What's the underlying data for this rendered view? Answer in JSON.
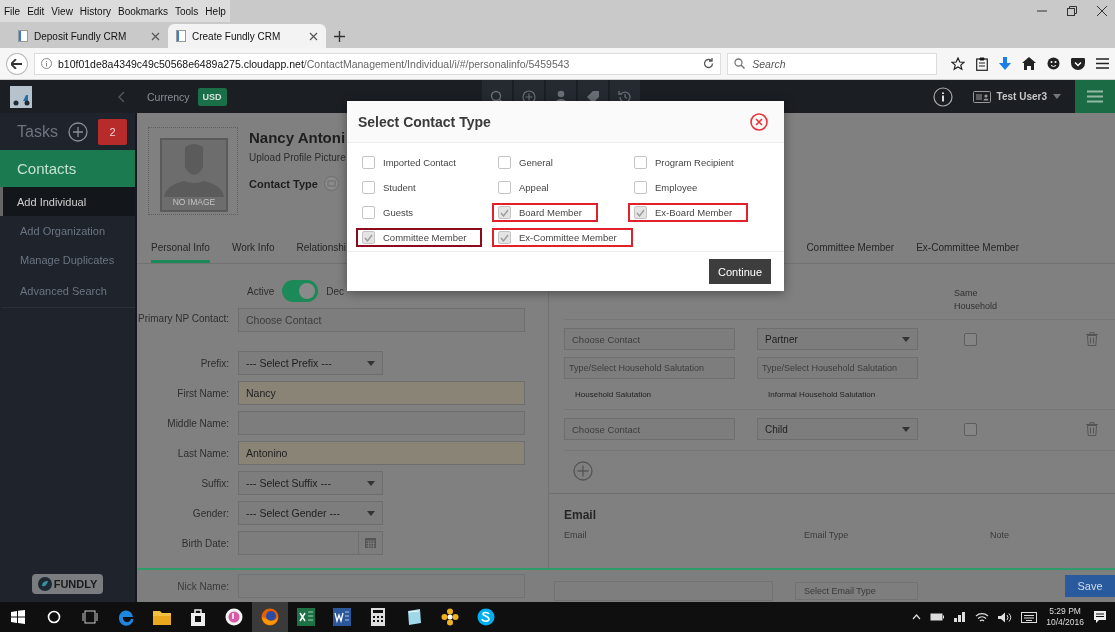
{
  "browser": {
    "menu": [
      "File",
      "Edit",
      "View",
      "History",
      "Bookmarks",
      "Tools",
      "Help"
    ],
    "tabs": [
      {
        "label": "Deposit Fundly CRM",
        "selected": false
      },
      {
        "label": "Create Fundly CRM",
        "selected": true
      }
    ],
    "url": {
      "host": "b10f01de8a4349c49c50568e6489a275.cloudapp.net",
      "path": "/ContactManagement/Individual/i/#/personalinfo/5459543"
    },
    "search": {
      "placeholder": "Search"
    }
  },
  "header": {
    "currency_label": "Currency",
    "currency": "USD",
    "user": "Test User3"
  },
  "sidebar": {
    "tasks": {
      "label": "Tasks",
      "count": "2"
    },
    "section": "Contacts",
    "items": [
      {
        "label": "Add Individual",
        "selected": true
      },
      {
        "label": "Add Organization",
        "selected": false
      },
      {
        "label": "Manage Duplicates",
        "selected": false
      },
      {
        "label": "Advanced Search",
        "selected": false
      }
    ],
    "logo": "FUNDLY"
  },
  "profile": {
    "name": "Nancy Antoni",
    "upload": "Upload Profile Picture",
    "no_image": "NO IMAGE",
    "contact_type": "Contact Type"
  },
  "tabs": {
    "left": [
      {
        "label": "Personal Info",
        "selected": true
      },
      {
        "label": "Work Info",
        "selected": false
      },
      {
        "label": "Relationshi",
        "selected": false
      }
    ],
    "right": [
      {
        "label": "Committee Member",
        "selected": false
      },
      {
        "label": "Ex-Committee Member",
        "selected": false
      }
    ]
  },
  "form": {
    "active_label": "Active",
    "active": true,
    "deceased_label": "Dec",
    "fields": [
      {
        "label": "Primary NP Contact:",
        "kind": "text",
        "placeholder": "Choose Contact",
        "highlighted": false
      },
      {
        "label": "Prefix:",
        "kind": "select",
        "value": "--- Select Prefix ---",
        "highlighted": false
      },
      {
        "label": "First Name:",
        "kind": "text",
        "value": "Nancy",
        "highlighted": true
      },
      {
        "label": "Middle Name:",
        "kind": "text",
        "highlighted": false
      },
      {
        "label": "Last Name:",
        "kind": "text",
        "value": "Antonino",
        "highlighted": true
      },
      {
        "label": "Suffix:",
        "kind": "select",
        "value": "--- Select Suffix ---",
        "highlighted": false
      },
      {
        "label": "Gender:",
        "kind": "select",
        "value": "--- Select Gender ---",
        "highlighted": false
      },
      {
        "label": "Birth Date:",
        "kind": "date",
        "highlighted": false
      }
    ]
  },
  "relationships": {
    "same_household_header": "Same Household",
    "rows": [
      {
        "contact_placeholder": "Choose Contact",
        "type": "Partner",
        "same_household": false,
        "salutations": [
          {
            "placeholder": "Type/Select Household Salutation",
            "label": "Household Salutation"
          },
          {
            "placeholder": "Type/Select Household Salutation",
            "label": "Informal Household Salutation"
          }
        ]
      },
      {
        "contact_placeholder": "Choose Contact",
        "type": "Child",
        "same_household": false
      }
    ]
  },
  "email": {
    "title": "Email",
    "columns": [
      "Email",
      "Email Type",
      "Note"
    ],
    "type_placeholder": "Select Email Type"
  },
  "footer": {
    "nick_name_label": "Nick Name:",
    "save": "Save"
  },
  "dialog": {
    "title": "Select Contact Type",
    "options": [
      {
        "label": "Imported Contact",
        "checked": false
      },
      {
        "label": "General",
        "checked": false
      },
      {
        "label": "Program Recipient",
        "checked": false
      },
      {
        "label": "Student",
        "checked": false
      },
      {
        "label": "Appeal",
        "checked": false
      },
      {
        "label": "Employee",
        "checked": false
      },
      {
        "label": "Guests",
        "checked": false
      },
      {
        "label": "Board Member",
        "checked": true,
        "color": "#e0202a"
      },
      {
        "label": "Ex-Board Member",
        "checked": true,
        "color": "#e0202a"
      },
      {
        "label": "Committee Member",
        "checked": true,
        "color": "#8b0a1e"
      },
      {
        "label": "Ex-Committee Member",
        "checked": true,
        "color": "#e0202a"
      }
    ],
    "continue": "Continue"
  },
  "taskbar": {
    "apps": [
      {
        "kind": "edge",
        "selected": false
      },
      {
        "kind": "folder",
        "selected": false
      },
      {
        "kind": "store",
        "selected": false
      },
      {
        "kind": "music",
        "selected": false
      },
      {
        "kind": "firefox",
        "selected": true
      },
      {
        "kind": "excel",
        "selected": false
      },
      {
        "kind": "word",
        "selected": false
      },
      {
        "kind": "calculator",
        "selected": false
      },
      {
        "kind": "notes",
        "selected": false
      },
      {
        "kind": "flower",
        "selected": false
      },
      {
        "kind": "skype",
        "selected": false
      }
    ],
    "time": "5:29 PM",
    "date": "10/4/2016"
  }
}
